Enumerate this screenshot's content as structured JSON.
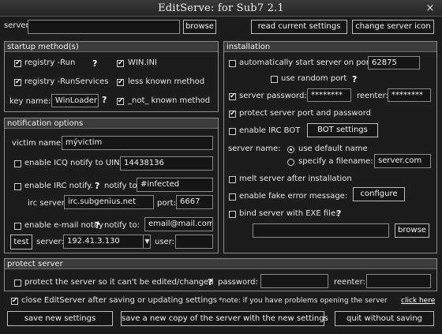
{
  "window": {
    "title": "EditServe: for Sub7 2.1",
    "close_glyph": "×"
  },
  "top": {
    "server_label": "server:",
    "server_value": "",
    "browse_label": "browse",
    "read_settings_label": "read current settings",
    "change_icon_label": "change server icon"
  },
  "startup": {
    "header": "startup method(s)",
    "registry_run": "registry -Run",
    "win_ini": "WIN.INI",
    "registry_runservices": "registry -RunServices",
    "less_known": "less known method",
    "key_name_label": "key name:",
    "key_name_value": "WinLoader",
    "not_known": "_not_ known method"
  },
  "notification": {
    "header": "notification options",
    "victim_name_label": "victim name:",
    "victim_name_value": "mývictim",
    "icq_label": "enable ICQ notify to UIN:",
    "icq_value": "14438136",
    "irc_label": "enable IRC notify.",
    "notify_to_label": "notify to:",
    "irc_notify_value": "#infected",
    "irc_server_label": "irc server:",
    "irc_server_value": "irc.subgenius.net",
    "port_label": "port:",
    "port_value": "6667",
    "email_label": "enable e-mail notify",
    "email_notify_to_label": "notify to:",
    "email_value": "email@mail.com",
    "test_label": "test",
    "server_label": "server:",
    "server_value": "192.41.3.130",
    "user_label": "user:",
    "user_value": ""
  },
  "installation": {
    "header": "installation",
    "auto_start_label": "automatically start server on port:",
    "port_value": "62875",
    "random_port_label": "use random port",
    "server_password_label": "server password:",
    "server_password_value": "********",
    "reenter_label": "reenter:",
    "reenter_value": "********",
    "protect_port_label": "protect server port and password",
    "irc_bot_label": "enable IRC BOT",
    "bot_settings_label": "BOT settings",
    "server_name_label": "server name:",
    "use_default_label": "use default name",
    "specify_label": "specify a filename:",
    "filename_value": "server.com",
    "melt_label": "melt server after installation",
    "fake_error_label": "enable fake error message:",
    "configure_label": "configure",
    "bind_label": "bind server with EXE file:",
    "bind_value": "",
    "browse_label": "browse"
  },
  "protect": {
    "header": "protect server",
    "protect_label": "protect the server so it can't be edited/changed",
    "password_label": "password:",
    "password_value": "",
    "reenter_label": "reenter:",
    "reenter_value": ""
  },
  "footer": {
    "close_after_label": "close EditServer after saving or updating settings",
    "note_text": "*note: if you have problems opening the server",
    "click_here": "click here",
    "save_new_label": "save new settings",
    "save_copy_label": "save a new copy of the server with the new settings",
    "quit_label": "quit without saving"
  },
  "help_glyph": "?",
  "checked_state": {
    "registry_run": true,
    "win_ini": true,
    "registry_runservices": true,
    "less_known": true,
    "not_known": true,
    "icq": false,
    "irc": false,
    "email": false,
    "auto_start": false,
    "random_port": false,
    "server_password": true,
    "protect_port": true,
    "irc_bot": false,
    "melt": false,
    "fake_error": false,
    "bind": false,
    "protect_server": false,
    "close_after": true,
    "radio_use_default": true,
    "radio_specify": false
  }
}
